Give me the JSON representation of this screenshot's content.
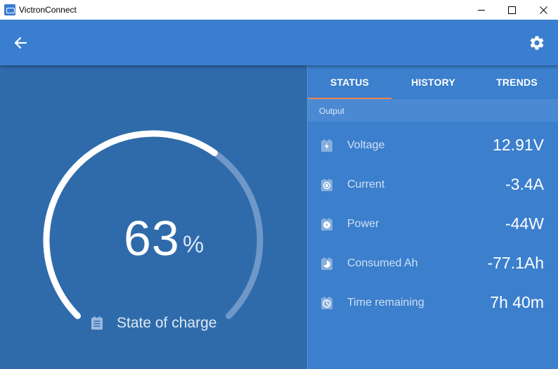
{
  "window": {
    "title": "VictronConnect",
    "icon": "victron-app-icon"
  },
  "appbar": {
    "back_icon": "arrow-left-icon",
    "settings_icon": "gear-icon"
  },
  "gauge": {
    "value": "63",
    "unit": "%",
    "fraction": 0.63,
    "label": "State of charge",
    "icon": "battery-list-icon"
  },
  "tabs": [
    {
      "label": "STATUS",
      "active": true
    },
    {
      "label": "HISTORY",
      "active": false
    },
    {
      "label": "TRENDS",
      "active": false
    }
  ],
  "section": {
    "title": "Output"
  },
  "rows": [
    {
      "label": "Voltage",
      "value": "12.91V",
      "icon": "battery-bolt-icon"
    },
    {
      "label": "Current",
      "value": "-3.4A",
      "icon": "battery-current-icon"
    },
    {
      "label": "Power",
      "value": "-44W",
      "icon": "battery-power-icon"
    },
    {
      "label": "Consumed Ah",
      "value": "-77.1Ah",
      "icon": "battery-consumed-icon"
    },
    {
      "label": "Time remaining",
      "value": "7h 40m",
      "icon": "battery-clock-icon"
    }
  ],
  "colors": {
    "appbar": "#3a7ecf",
    "left_panel": "#2f6bab",
    "right_panel": "#3b7fcd",
    "tab_indicator": "#f0834a"
  }
}
